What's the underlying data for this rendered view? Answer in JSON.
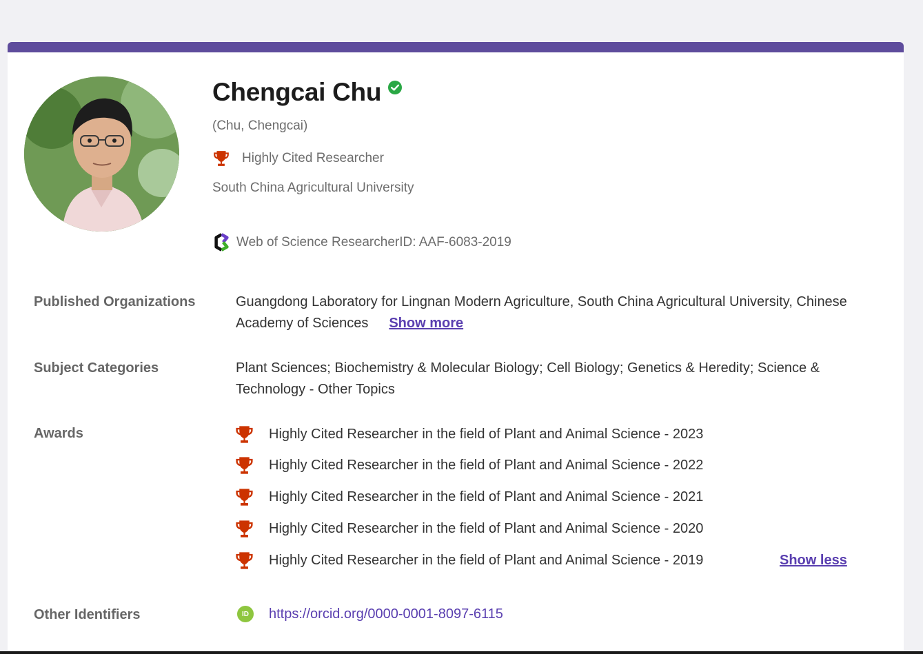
{
  "profile": {
    "name": "Chengcai Chu",
    "alt_name": "(Chu, Chengcai)",
    "badge_label": "Highly Cited Researcher",
    "affiliation": "South China Agricultural University",
    "researcher_id": "Web of Science ResearcherID: AAF-6083-2019"
  },
  "organizations": {
    "label": "Published Organizations",
    "value": "Guangdong Laboratory for Lingnan Modern Agriculture,  South China Agricultural University,  Chinese Academy of Sciences",
    "show_more": "Show more"
  },
  "subjects": {
    "label": "Subject Categories",
    "value": "Plant Sciences;  Biochemistry & Molecular Biology;  Cell Biology;  Genetics & Heredity;  Science & Technology - Other Topics"
  },
  "awards": {
    "label": "Awards",
    "items": [
      "Highly Cited Researcher in the field of Plant and Animal Science - 2023",
      "Highly Cited Researcher in the field of Plant and Animal Science - 2022",
      "Highly Cited Researcher in the field of Plant and Animal Science - 2021",
      "Highly Cited Researcher in the field of Plant and Animal Science - 2020",
      "Highly Cited Researcher in the field of Plant and Animal Science - 2019"
    ],
    "show_less": "Show less"
  },
  "identifiers": {
    "label": "Other Identifiers",
    "orcid_badge": "ID",
    "orcid_url": "https://orcid.org/0000-0001-8097-6115"
  },
  "icons": {
    "verified": "check-circle-icon",
    "trophy": "trophy-icon",
    "researcher_id": "web-of-science-logo-icon",
    "orcid": "orcid-icon"
  },
  "colors": {
    "accent_bar": "#5e4c9c",
    "link": "#5a3fb0",
    "trophy": "#cc3300",
    "verified": "#2aa845",
    "orcid": "#8ec63f"
  }
}
